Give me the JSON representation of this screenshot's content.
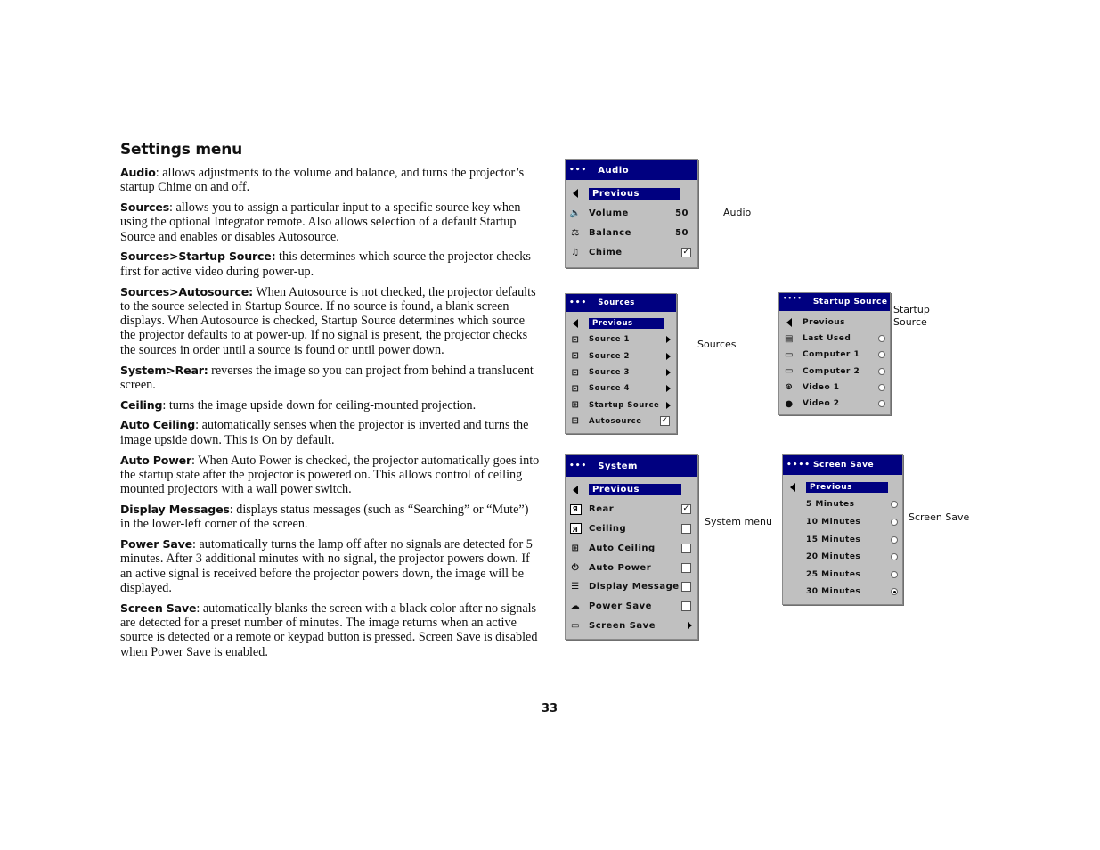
{
  "document": {
    "heading": "Settings menu",
    "paragraphs": [
      {
        "term": "Audio",
        "sep": ": ",
        "text": "allows adjustments to the volume and balance, and turns the projector’s startup Chime on and off."
      },
      {
        "term": "Sources",
        "sep": ": ",
        "text": "allows you to assign a particular input to a specific source key when using the optional Integrator remote. Also allows selection of a default Startup Source and enables or disables Autosource."
      },
      {
        "term": "Sources>Startup Source:",
        "sep": " ",
        "text": "this determines which source the projector checks first for active video during power-up."
      },
      {
        "term": "Sources>Autosource:",
        "sep": " ",
        "text": "When Autosource is not checked, the projector defaults to the source selected in Startup Source. If no source is found, a blank screen displays. When Autosource is checked, Startup Source determines which source the projector defaults to at power-up. If no signal is present, the projector checks the sources in order until a source is found or until power down."
      },
      {
        "term": "System>Rear:",
        "sep": " ",
        "text": "reverses the image so you can project from behind a translucent screen."
      },
      {
        "term": "Ceiling",
        "sep": ": ",
        "text": "turns the image upside down for ceiling-mounted projection."
      },
      {
        "term": "Auto Ceiling",
        "sep": ": ",
        "text": "automatically senses when the projector is inverted and turns the image upside down. This is On by default."
      },
      {
        "term": "Auto Power",
        "sep": ": ",
        "text": "When Auto Power is checked, the projector automatically goes into the startup state after the projector is powered on. This allows control of ceiling mounted projectors with a wall power switch."
      },
      {
        "term": "Display Messages",
        "sep": ": ",
        "text": "displays status messages (such as “Searching” or “Mute”) in the lower-left corner of the screen."
      },
      {
        "term": "Power Save",
        "sep": ": ",
        "text": "automatically turns the lamp off after no signals are detected for 5 minutes. After 3 additional minutes with no signal, the projector powers down. If an active signal is received before the projector powers down, the image will be displayed."
      },
      {
        "term": "Screen Save",
        "sep": ": ",
        "text": "automatically blanks the screen with a black color after no signals are detected for a preset number of minutes. The image returns when an active source is detected or a remote or keypad button is pressed. Screen Save is disabled when Power Save is enabled."
      }
    ],
    "page_number": "33"
  },
  "colors": {
    "title_bar": "#000080",
    "menu_bg": "#c0c0c0",
    "highlight": "#000080"
  },
  "menus": {
    "audio": {
      "title_dots": "•••",
      "title": "Audio",
      "caption": "Audio",
      "previous": "Previous",
      "items": [
        {
          "label": "Volume",
          "icon": "volume-icon",
          "value": "50"
        },
        {
          "label": "Balance",
          "icon": "balance-icon",
          "value": "50"
        },
        {
          "label": "Chime",
          "icon": "chime-icon",
          "checked": true
        }
      ]
    },
    "sources": {
      "title_dots": "•••",
      "title": "Sources",
      "caption": "Sources",
      "previous": "Previous",
      "items": [
        {
          "label": "Source 1",
          "icon": "source-icon",
          "submenu": true
        },
        {
          "label": "Source 2",
          "icon": "source-icon",
          "submenu": true
        },
        {
          "label": "Source 3",
          "icon": "source-icon",
          "submenu": true
        },
        {
          "label": "Source 4",
          "icon": "source-icon",
          "submenu": true
        },
        {
          "label": "Startup Source",
          "icon": "startup-source-icon",
          "submenu": true
        },
        {
          "label": "Autosource",
          "icon": "autosource-icon",
          "checked": true
        }
      ]
    },
    "startup_source": {
      "title_dots": "••••",
      "title": "Startup Source",
      "caption_line1": "Startup",
      "caption_line2": "Source",
      "previous": "Previous",
      "items": [
        {
          "label": "Last Used",
          "icon": "last-used-icon",
          "selected": false
        },
        {
          "label": "Computer 1",
          "icon": "computer-icon",
          "selected": false
        },
        {
          "label": "Computer 2",
          "icon": "computer-icon",
          "selected": false
        },
        {
          "label": "Video 1",
          "icon": "svideo-icon",
          "selected": false
        },
        {
          "label": "Video 2",
          "icon": "composite-video-icon",
          "selected": false
        }
      ]
    },
    "system": {
      "title_dots": "•••",
      "title": "System",
      "caption": "System menu",
      "previous": "Previous",
      "items": [
        {
          "label": "Rear",
          "icon": "rear-icon",
          "checked": true
        },
        {
          "label": "Ceiling",
          "icon": "ceiling-icon",
          "checked": false
        },
        {
          "label": "Auto Ceiling",
          "icon": "auto-ceiling-icon",
          "checked": false
        },
        {
          "label": "Auto Power",
          "icon": "auto-power-icon",
          "checked": false
        },
        {
          "label": "Display Message",
          "icon": "display-message-icon",
          "checked": false
        },
        {
          "label": "Power Save",
          "icon": "power-save-icon",
          "checked": false
        },
        {
          "label": "Screen Save",
          "icon": "screen-save-icon",
          "submenu": true
        }
      ]
    },
    "screen_save": {
      "title_dots": "••••",
      "title": "Screen Save",
      "caption": "Screen Save",
      "previous": "Previous",
      "items": [
        {
          "label": "5 Minutes",
          "selected": false
        },
        {
          "label": "10 Minutes",
          "selected": false
        },
        {
          "label": "15 Minutes",
          "selected": false
        },
        {
          "label": "20 Minutes",
          "selected": false
        },
        {
          "label": "25 Minutes",
          "selected": false
        },
        {
          "label": "30 Minutes",
          "selected": true
        }
      ]
    }
  }
}
